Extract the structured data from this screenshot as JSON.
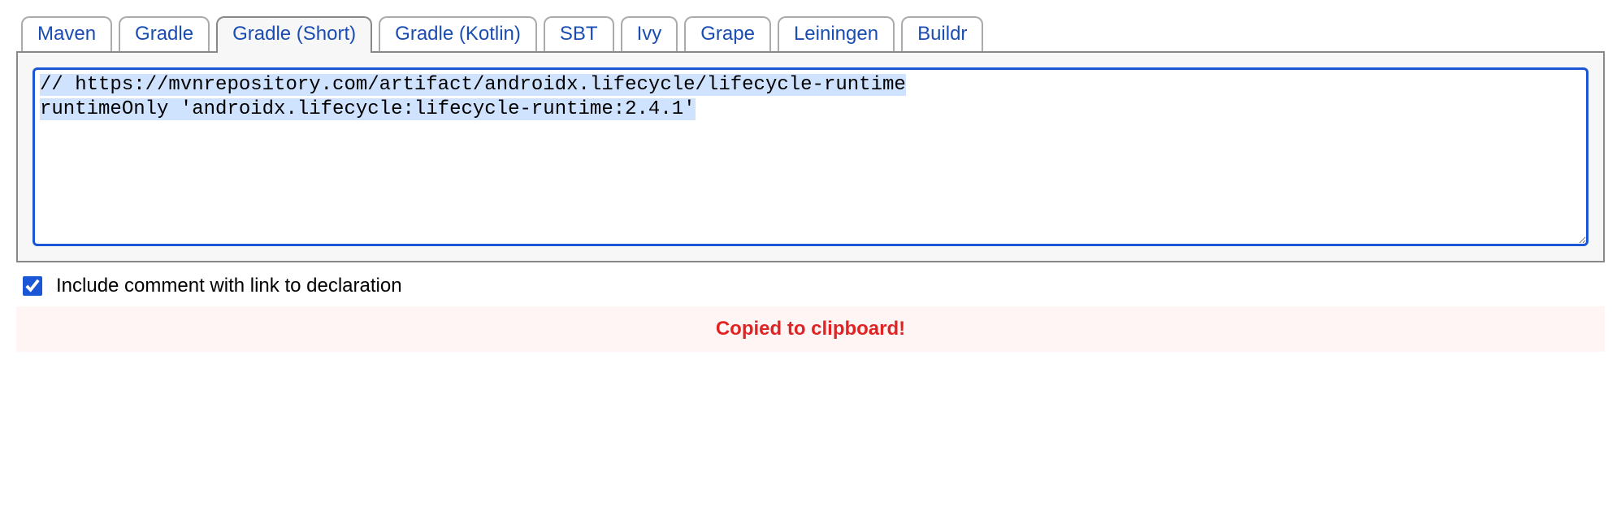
{
  "tabs": [
    {
      "label": "Maven",
      "active": false
    },
    {
      "label": "Gradle",
      "active": false
    },
    {
      "label": "Gradle (Short)",
      "active": true
    },
    {
      "label": "Gradle (Kotlin)",
      "active": false
    },
    {
      "label": "SBT",
      "active": false
    },
    {
      "label": "Ivy",
      "active": false
    },
    {
      "label": "Grape",
      "active": false
    },
    {
      "label": "Leiningen",
      "active": false
    },
    {
      "label": "Buildr",
      "active": false
    }
  ],
  "snippet": {
    "comment_url": "https://mvnrepository.com/artifact/androidx.lifecycle/lifecycle-runtime",
    "line1": "// https://mvnrepository.com/artifact/androidx.lifecycle/lifecycle-runtime",
    "line2": "runtimeOnly 'androidx.lifecycle:lifecycle-runtime:2.4.1'",
    "group": "androidx.lifecycle",
    "artifact": "lifecycle-runtime",
    "version": "2.4.1",
    "configuration": "runtimeOnly"
  },
  "include_comment": {
    "checked": true,
    "label": "Include comment with link to declaration"
  },
  "copied_message": "Copied to clipboard!"
}
